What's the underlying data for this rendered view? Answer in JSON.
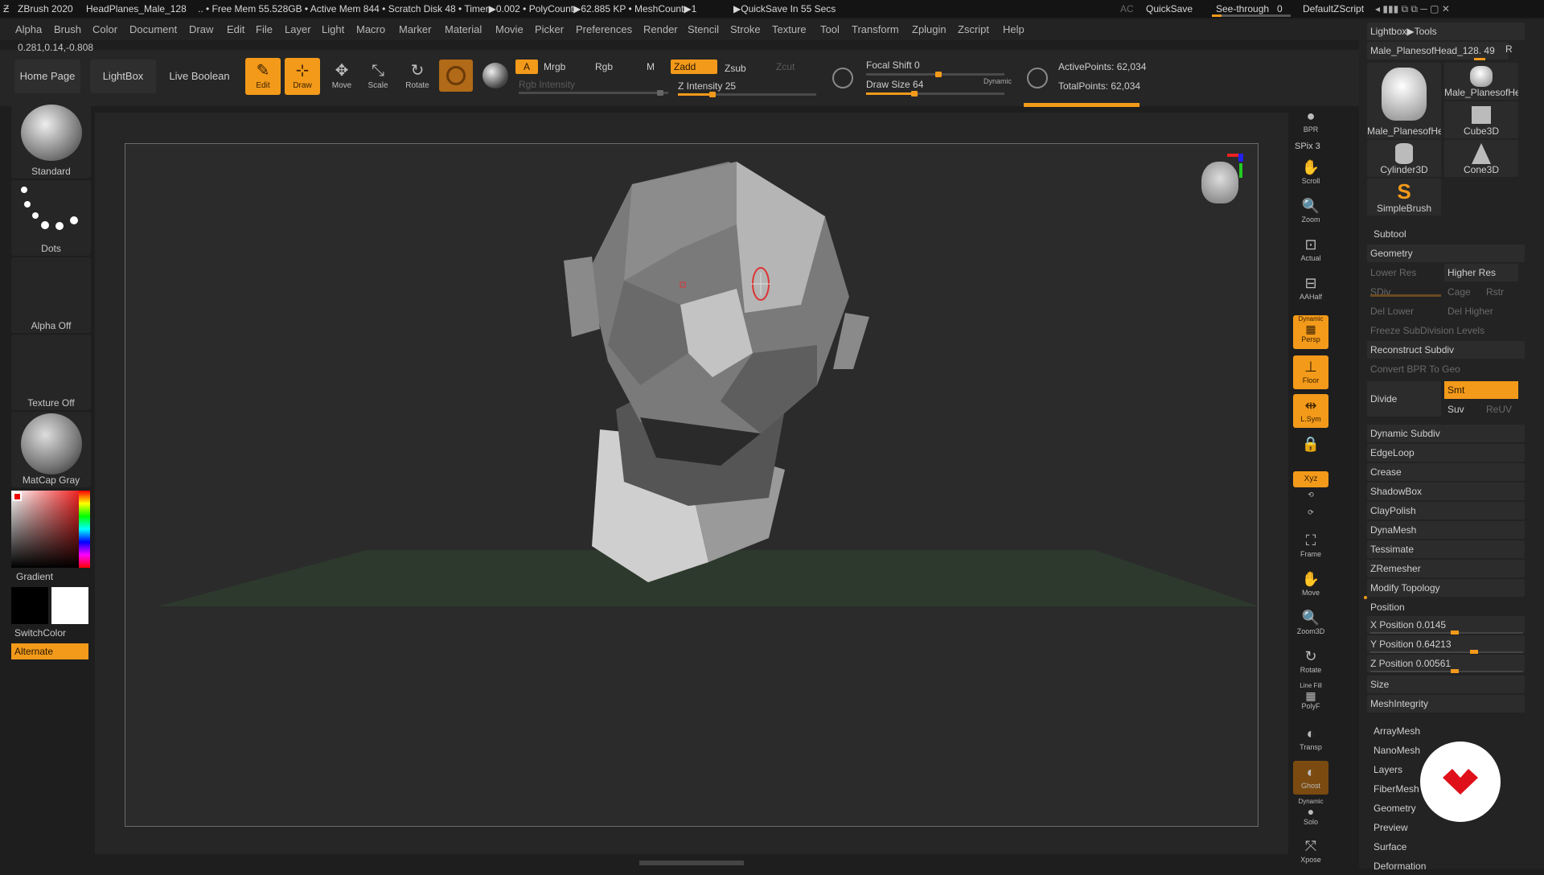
{
  "titlebar": {
    "app": "ZBrush 2020",
    "doc": "HeadPlanes_Male_128",
    "stats": ".. • Free Mem 55.528GB • Active Mem 844 • Scratch Disk 48 • Timer▶0.002 • PolyCount▶62.885 KP • MeshCount▶1",
    "quicksave_msg": "▶QuickSave In 55 Secs",
    "ac": "AC",
    "quicksave": "QuickSave",
    "seethrough": "See-through",
    "seethrough_value": "0",
    "script": "DefaultZScript"
  },
  "menu": [
    "Alpha",
    "Brush",
    "Color",
    "Document",
    "Draw",
    "Edit",
    "File",
    "Layer",
    "Light",
    "Macro",
    "Marker",
    "Material",
    "Movie",
    "Picker",
    "Preferences",
    "Render",
    "Stencil",
    "Stroke",
    "Texture",
    "Tool",
    "Transform",
    "Zplugin",
    "Zscript",
    "Help"
  ],
  "coords": "0.281,0.14,-0.808",
  "toolbar": {
    "home": "Home Page",
    "lightbox": "LightBox",
    "liveboolean": "Live Boolean",
    "edit": "Edit",
    "draw": "Draw",
    "move": "Move",
    "scale": "Scale",
    "rotate": "Rotate",
    "a": "A",
    "mrgb": "Mrgb",
    "rgb": "Rgb",
    "m": "M",
    "zadd": "Zadd",
    "zsub": "Zsub",
    "zcut": "Zcut",
    "rgb_intensity": "Rgb Intensity",
    "z_intensity": "Z Intensity 25",
    "focal_shift": "Focal Shift 0",
    "draw_size": "Draw Size 64",
    "dynamic": "Dynamic",
    "active_points": "ActivePoints: 62,034",
    "total_points": "TotalPoints: 62,034",
    "z_intensity_level": 0.25,
    "draw_size_level": 0.35
  },
  "leftpanel": {
    "brush": "Standard",
    "stroke": "Dots",
    "alpha": "Alpha Off",
    "texture": "Texture Off",
    "material": "MatCap Gray",
    "gradient": "Gradient",
    "switchcolor": "SwitchColor",
    "alternate": "Alternate"
  },
  "rightshelf": [
    "BPR",
    "SPix 3",
    "Scroll",
    "Zoom",
    "Actual",
    "AAHalf",
    "Persp",
    "Floor",
    "L.Sym",
    "",
    "Xyz",
    "",
    "",
    "Frame",
    "Move",
    "Zoom3D",
    "Rotate",
    "PolyF",
    "Transp",
    "Ghost",
    "Solo",
    "Xpose"
  ],
  "rightshelf_labels": {
    "dynamic": "Dynamic",
    "linefill": "Line Fill"
  },
  "tray": {
    "header": "Lightbox▶Tools",
    "current_tool": "Male_PlanesofHead_128. 49",
    "r": "R",
    "tools": [
      "Male_PlanesofHe",
      "Male_PlanesofHe",
      "Cube3D",
      "Cylinder3D",
      "Cone3D",
      "SimpleBrush"
    ],
    "subtool": "Subtool",
    "geometry": "Geometry",
    "lower_res": "Lower Res",
    "higher_res": "Higher Res",
    "sdiv": "SDiv",
    "cage": "Cage",
    "rstr": "Rstr",
    "del_lower": "Del Lower",
    "del_higher": "Del Higher",
    "freeze": "Freeze SubDivision Levels",
    "reconstruct": "Reconstruct Subdiv",
    "convert_bpr": "Convert BPR To Geo",
    "divide": "Divide",
    "smt": "Smt",
    "suv": "Suv",
    "reuv": "ReUV",
    "sections": [
      "Dynamic Subdiv",
      "EdgeLoop",
      "Crease",
      "ShadowBox",
      "ClayPolish",
      "DynaMesh",
      "Tessimate",
      "ZRemesher",
      "Modify Topology"
    ],
    "position": "Position",
    "x_pos": "X Position 0.0145",
    "y_pos": "Y Position 0.64213",
    "z_pos": "Z Position 0.00561",
    "size": "Size",
    "meshintegrity": "MeshIntegrity",
    "bottom": [
      "ArrayMesh",
      "NanoMesh",
      "Layers",
      "FiberMesh",
      "Geometry HD",
      "Preview",
      "Surface",
      "Deformation"
    ]
  },
  "colors": {
    "accent": "#f39a1a",
    "bg": "#1e1e1e",
    "panel": "#262626"
  }
}
